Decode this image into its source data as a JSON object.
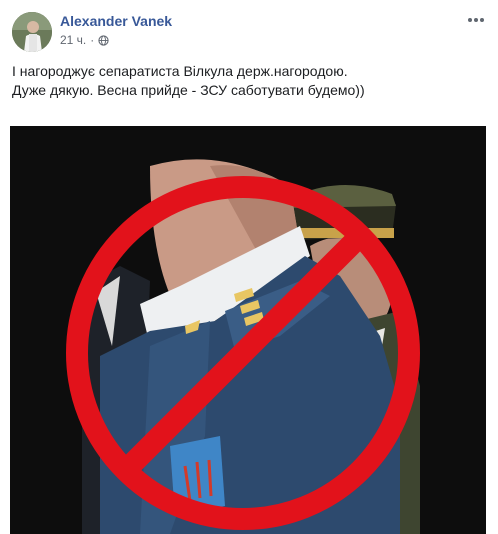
{
  "post": {
    "author_name": "Alexander Vanek",
    "time": "21 ч.",
    "dot": "·",
    "privacy_icon": "globe-icon",
    "more_icon": "more-dots-icon",
    "text_lines": [
      "І нагороджує сепаратиста Вілкула держ.нагородою.",
      "Дуже дякую. Весна прийде - ЗСУ саботувати будемо))"
    ]
  },
  "image": {
    "description_icon": "no-symbol-icon",
    "colors": {
      "frame": "#ffffff",
      "background": "#0d0d0d",
      "prohibition": "#e2121b",
      "uniform": "#2d4a6e",
      "shirt": "#eef0f2",
      "skin": "#c99a86"
    }
  }
}
